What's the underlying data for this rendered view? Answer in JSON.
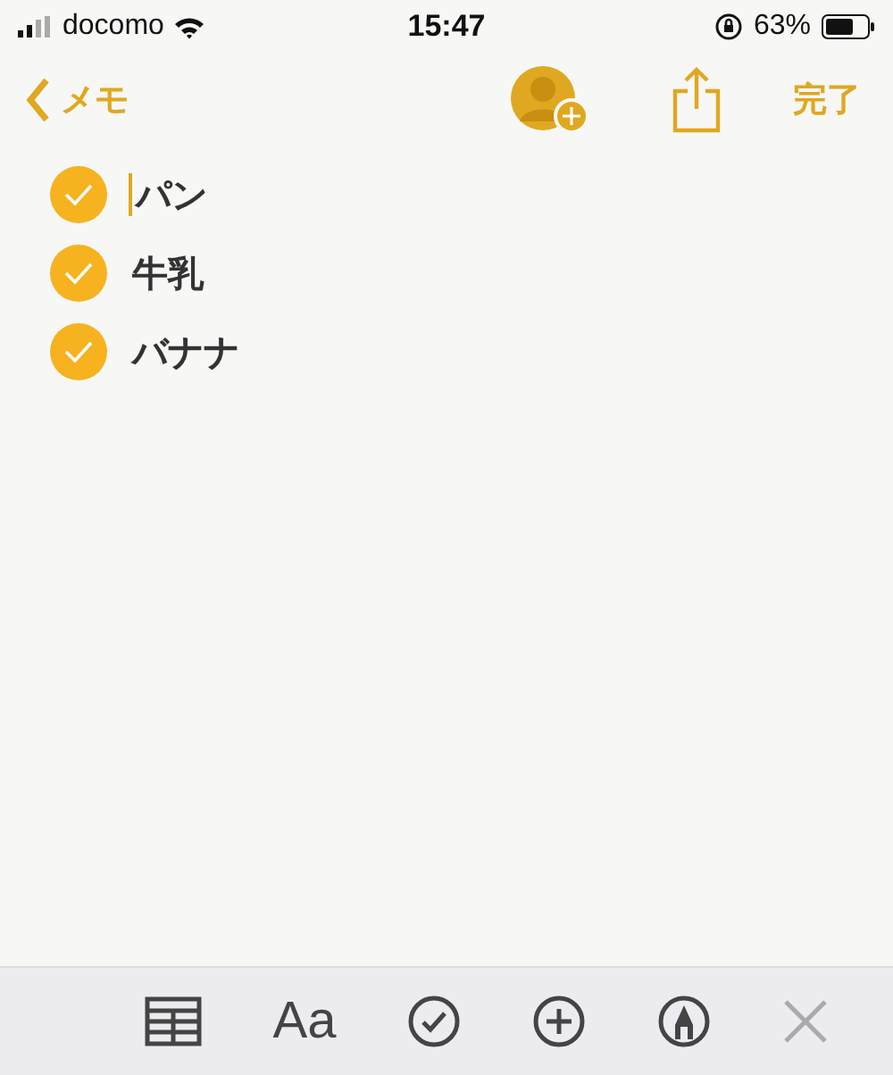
{
  "status_bar": {
    "carrier": "docomo",
    "time": "15:47",
    "battery": "63%"
  },
  "nav": {
    "back": "メモ",
    "done": "完了"
  },
  "checklist": [
    {
      "text": "パン",
      "checked": true,
      "focused": true
    },
    {
      "text": "牛乳",
      "checked": true,
      "focused": false
    },
    {
      "text": "バナナ",
      "checked": true,
      "focused": false
    }
  ],
  "toolbar": [
    {
      "kind": "table",
      "disabled": false
    },
    {
      "kind": "format",
      "label": "Aa",
      "disabled": false
    },
    {
      "kind": "checklist",
      "disabled": false
    },
    {
      "kind": "add",
      "disabled": false
    },
    {
      "kind": "markup",
      "disabled": false
    },
    {
      "kind": "close",
      "disabled": true
    }
  ]
}
